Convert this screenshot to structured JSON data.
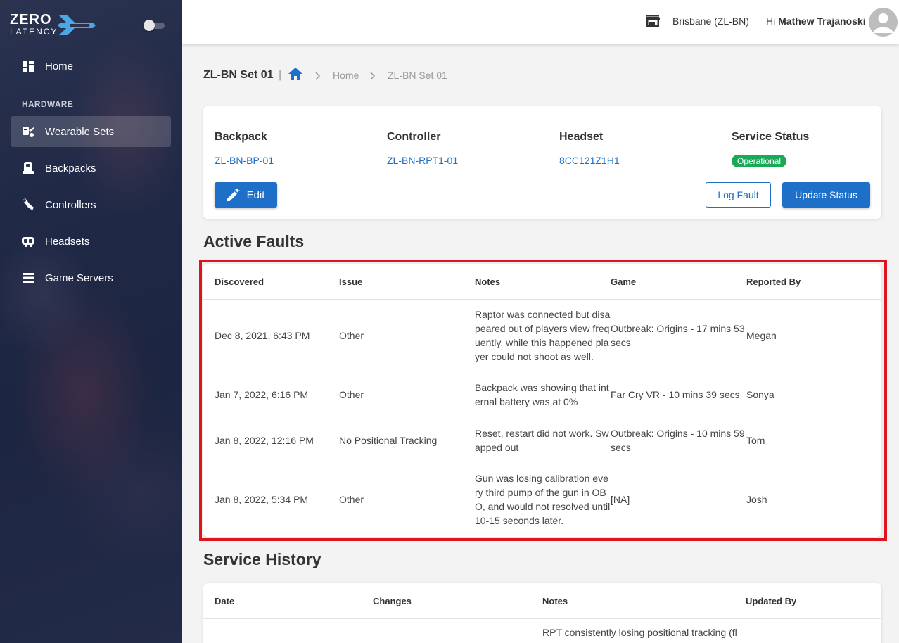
{
  "app": {
    "logo_line1": "ZERO",
    "logo_line2": "LATENCY"
  },
  "sidebar": {
    "section_label": "HARDWARE",
    "items": [
      {
        "label": "Home",
        "icon": "dashboard-icon"
      },
      {
        "label": "Wearable Sets",
        "icon": "wearable-sets-icon",
        "active": true
      },
      {
        "label": "Backpacks",
        "icon": "backpack-icon"
      },
      {
        "label": "Controllers",
        "icon": "controller-icon"
      },
      {
        "label": "Headsets",
        "icon": "headset-icon"
      },
      {
        "label": "Game Servers",
        "icon": "server-icon"
      }
    ]
  },
  "topbar": {
    "location": "Brisbane (ZL-BN)",
    "greeting_prefix": "Hi",
    "user_name": "Mathew Trajanoski"
  },
  "breadcrumb": {
    "title": "ZL-BN Set 01",
    "separator": "|",
    "items": [
      "Home",
      "ZL-BN Set 01"
    ]
  },
  "summary": {
    "backpack_label": "Backpack",
    "backpack_value": "ZL-BN-BP-01",
    "controller_label": "Controller",
    "controller_value": "ZL-BN-RPT1-01",
    "headset_label": "Headset",
    "headset_value": "8CC121Z1H1",
    "status_label": "Service Status",
    "status_value": "Operational",
    "edit_label": "Edit",
    "log_fault_label": "Log Fault",
    "update_status_label": "Update Status"
  },
  "active_faults": {
    "title": "Active Faults",
    "columns": [
      "Discovered",
      "Issue",
      "Notes",
      "Game",
      "Reported By"
    ],
    "rows": [
      {
        "discovered": "Dec 8, 2021, 6:43 PM",
        "issue": "Other",
        "notes": "Raptor was connected but disapeared out of players view frequently. while this happened player could not shoot as well.",
        "game": "Outbreak: Origins - 17 mins 53 secs",
        "reported_by": "Megan"
      },
      {
        "discovered": "Jan 7, 2022, 6:16 PM",
        "issue": "Other",
        "notes": "Backpack was showing that internal battery was at 0%",
        "game": "Far Cry VR - 10 mins 39 secs",
        "reported_by": "Sonya"
      },
      {
        "discovered": "Jan 8, 2022, 12:16 PM",
        "issue": "No Positional Tracking",
        "notes": "Reset, restart did not work. Swapped out",
        "game": "Outbreak: Origins - 10 mins 59 secs",
        "reported_by": "Tom"
      },
      {
        "discovered": "Jan 8, 2022, 5:34 PM",
        "issue": "Other",
        "notes": "Gun was losing calibration every third pump of the gun in OBO, and would not resolved until 10-15 seconds later.",
        "game": "[NA]",
        "reported_by": "Josh"
      }
    ]
  },
  "service_history": {
    "title": "Service History",
    "columns": [
      "Date",
      "Changes",
      "Notes",
      "Updated By"
    ],
    "first_row_notes": "RPT consistently losing positional tracking (fl"
  },
  "colors": {
    "accent": "#1e6fc8",
    "status_ok": "#19a957",
    "highlight": "#e0141e",
    "sidebar": "#1f2845"
  }
}
